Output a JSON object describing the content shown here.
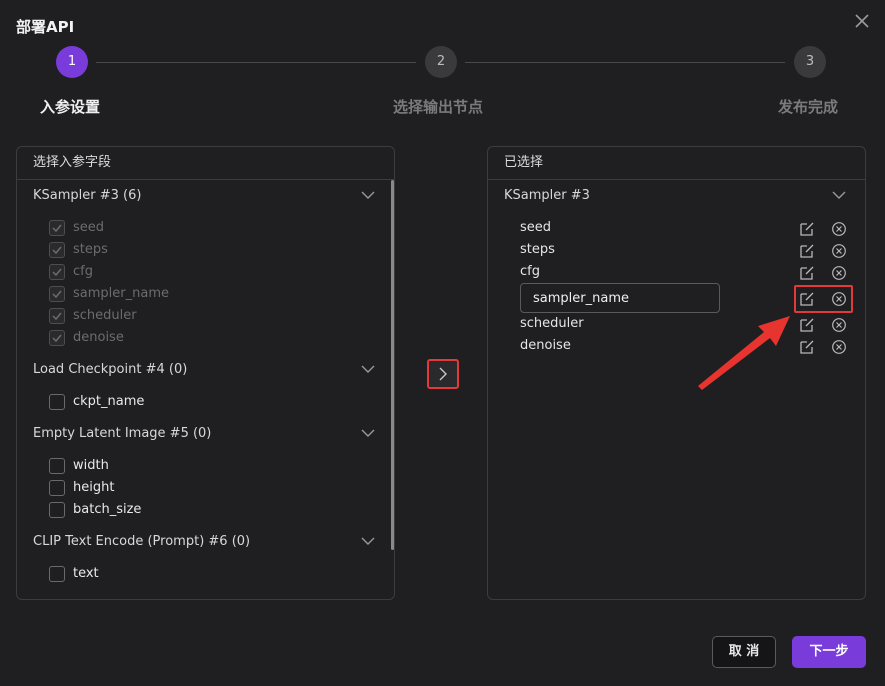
{
  "dialog": {
    "title": "部署API",
    "close_icon": "close-icon"
  },
  "stepper": {
    "steps": [
      {
        "number": "1",
        "label": "入参设置",
        "state": "active"
      },
      {
        "number": "2",
        "label": "选择输出节点",
        "state": "inactive"
      },
      {
        "number": "3",
        "label": "发布完成",
        "state": "inactive"
      }
    ],
    "active_color": "#7a3bdb"
  },
  "left_panel": {
    "header": "选择入参字段",
    "groups": [
      {
        "label": "KSampler #3 (6)",
        "items": [
          {
            "label": "seed",
            "checked": true,
            "disabled": true
          },
          {
            "label": "steps",
            "checked": true,
            "disabled": true
          },
          {
            "label": "cfg",
            "checked": true,
            "disabled": true
          },
          {
            "label": "sampler_name",
            "checked": true,
            "disabled": true
          },
          {
            "label": "scheduler",
            "checked": true,
            "disabled": true
          },
          {
            "label": "denoise",
            "checked": true,
            "disabled": true
          }
        ]
      },
      {
        "label": "Load Checkpoint #4 (0)",
        "items": [
          {
            "label": "ckpt_name",
            "checked": false,
            "disabled": false
          }
        ]
      },
      {
        "label": "Empty Latent Image #5 (0)",
        "items": [
          {
            "label": "width",
            "checked": false,
            "disabled": false
          },
          {
            "label": "height",
            "checked": false,
            "disabled": false
          },
          {
            "label": "batch_size",
            "checked": false,
            "disabled": false
          }
        ]
      },
      {
        "label": "CLIP Text Encode (Prompt) #6 (0)",
        "items": [
          {
            "label": "text",
            "checked": false,
            "disabled": false
          }
        ]
      }
    ]
  },
  "transfer": {
    "icon": "chevron-right-icon"
  },
  "right_panel": {
    "header": "已选择",
    "group_label": "KSampler #3",
    "items": [
      {
        "label": "seed"
      },
      {
        "label": "steps"
      },
      {
        "label": "cfg"
      },
      {
        "label": "sampler_name",
        "editing": true
      },
      {
        "label": "scheduler"
      },
      {
        "label": "denoise"
      }
    ],
    "edit_icon": "edit-icon",
    "remove_icon": "remove-circle-icon"
  },
  "annotation": {
    "highlight_color": "#e03a3a"
  },
  "footer": {
    "cancel_label": "取 消",
    "next_label": "下一步"
  }
}
